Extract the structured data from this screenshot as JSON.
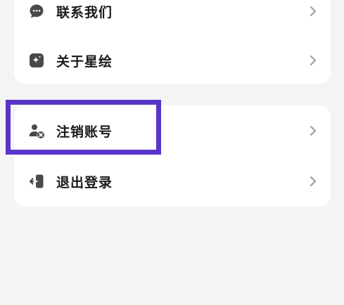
{
  "menu_group_1": {
    "items": [
      {
        "label": "联系我们",
        "icon": "chat-bubble-icon"
      },
      {
        "label": "关于星绘",
        "icon": "sparkle-icon"
      }
    ]
  },
  "menu_group_2": {
    "items": [
      {
        "label": "注销账号",
        "icon": "user-remove-icon"
      },
      {
        "label": "退出登录",
        "icon": "logout-icon"
      }
    ]
  },
  "colors": {
    "background": "#f4f4f5",
    "card": "#ffffff",
    "text": "#1a1a1a",
    "icon": "#4a4a4a",
    "chevron": "#9a9a9a",
    "highlight_border": "#5a34c9"
  }
}
